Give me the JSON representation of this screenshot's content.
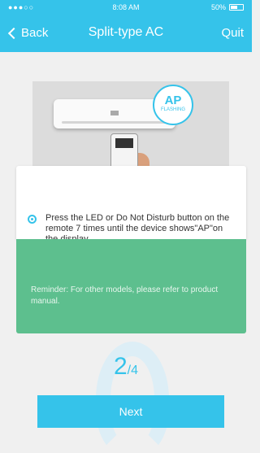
{
  "status": {
    "carrier": "●●●○○",
    "time": "8:08 AM",
    "battery": "50%"
  },
  "header": {
    "back_label": "Back",
    "title": "Split-type AC",
    "quit_label": "Quit"
  },
  "illustration": {
    "bubble_title": "AP",
    "bubble_sub": "FLASHING"
  },
  "instruction": "Press the LED or Do Not Disturb button on the remote 7 times until the device shows\"AP\"on the display.",
  "reminder": "Reminder: For other models, please refer to product manual.",
  "step": {
    "current": "2",
    "total": "4"
  },
  "next_label": "Next",
  "colors": {
    "accent": "#35c3ea",
    "reminder_bg": "#5dbf8e"
  }
}
